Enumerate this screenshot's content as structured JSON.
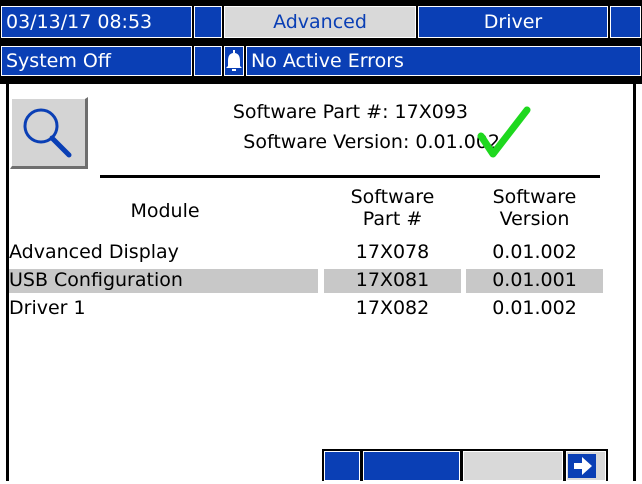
{
  "header": {
    "datetime": "03/13/17 08:53",
    "tabs": [
      {
        "label": "Advanced",
        "state": "selected"
      },
      {
        "label": "Driver",
        "state": "normal"
      }
    ]
  },
  "status": {
    "system": "System Off",
    "errors_icon": "alarm-bell-icon",
    "errors": "No Active Errors"
  },
  "software": {
    "part_line": "Software Part #: 17X093",
    "version_line": "Software Version: 0.01.002",
    "status_icon": "checkmark-icon"
  },
  "table": {
    "headers": {
      "module": "Module",
      "part_l1": "Software",
      "part_l2": "Part #",
      "version_l1": "Software",
      "version_l2": "Version"
    },
    "rows": [
      {
        "module": "Advanced Display",
        "part": "17X078",
        "version": "0.01.002",
        "selected": false
      },
      {
        "module": "USB Configuration",
        "part": "17X081",
        "version": "0.01.001",
        "selected": true
      },
      {
        "module": "Driver 1",
        "part": "17X082",
        "version": "0.01.002",
        "selected": false
      }
    ]
  },
  "icons": {
    "search": "magnifier-icon",
    "next": "right-arrow-icon"
  },
  "colors": {
    "accent_blue": "#0a3fb5",
    "tab_gray": "#d9d9d9",
    "check_green": "#1ed81e",
    "selected_row": "#c8c8c8"
  }
}
